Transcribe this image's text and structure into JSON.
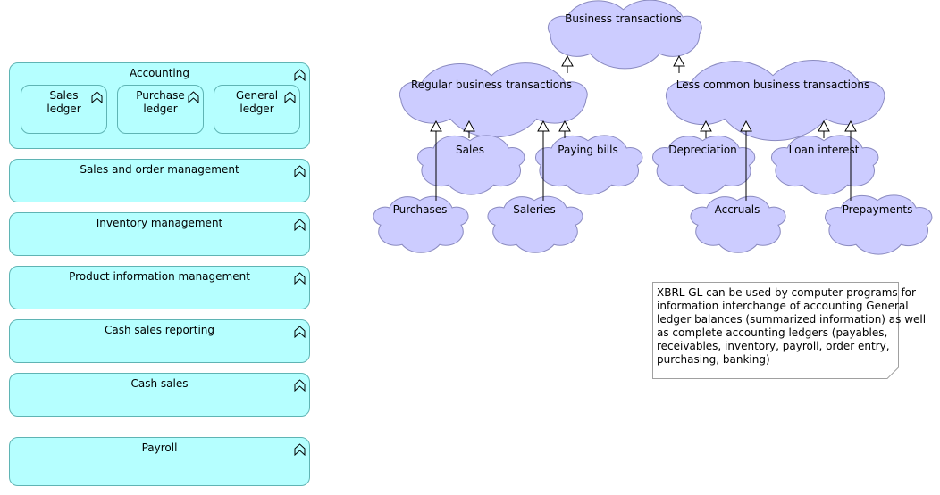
{
  "colors": {
    "function_fill": "#b5ffff",
    "function_border": "#5fb4b4",
    "event_fill": "#ccccff",
    "event_border": "#8a8ac0"
  },
  "functions": {
    "accounting": {
      "label": "Accounting",
      "icon": "function-icon",
      "children": [
        {
          "label": "Sales\nledger"
        },
        {
          "label": "Purchase\nledger"
        },
        {
          "label": "General\nledger"
        }
      ]
    },
    "others": [
      {
        "label": "Sales and order management"
      },
      {
        "label": "Inventory management"
      },
      {
        "label": "Product information management"
      },
      {
        "label": "Cash sales reporting"
      },
      {
        "label": "Cash sales"
      },
      {
        "label": "Payroll"
      }
    ]
  },
  "events": [
    {
      "id": "bt",
      "label": "Business transactions"
    },
    {
      "id": "reg",
      "label": "Regular business transactions"
    },
    {
      "id": "less",
      "label": "Less common business transactions"
    },
    {
      "id": "sales",
      "label": "Sales"
    },
    {
      "id": "paying",
      "label": "Paying bills"
    },
    {
      "id": "depr",
      "label": "Depreciation"
    },
    {
      "id": "loan",
      "label": "Loan interest"
    },
    {
      "id": "purch",
      "label": "Purchases"
    },
    {
      "id": "saler",
      "label": "Saleries"
    },
    {
      "id": "accr",
      "label": "Accruals"
    },
    {
      "id": "prep",
      "label": "Prepayments"
    }
  ],
  "relationships": [
    {
      "type": "specialization",
      "from": "reg",
      "to": "bt"
    },
    {
      "type": "specialization",
      "from": "less",
      "to": "bt"
    },
    {
      "type": "specialization",
      "from": "purch",
      "to": "reg"
    },
    {
      "type": "specialization",
      "from": "sales",
      "to": "reg"
    },
    {
      "type": "specialization",
      "from": "saler",
      "to": "reg"
    },
    {
      "type": "specialization",
      "from": "paying",
      "to": "reg"
    },
    {
      "type": "specialization",
      "from": "depr",
      "to": "less"
    },
    {
      "type": "specialization",
      "from": "accr",
      "to": "less"
    },
    {
      "type": "specialization",
      "from": "loan",
      "to": "less"
    },
    {
      "type": "specialization",
      "from": "prep",
      "to": "less"
    }
  ],
  "note": {
    "lines": [
      "XBRL GL can be used by computer programs for",
      "information interchange of accounting General",
      "ledger balances (summarized information) as well",
      "as complete accounting ledgers (payables,",
      "receivables, inventory, payroll, order entry,",
      "purchasing, banking)"
    ]
  }
}
